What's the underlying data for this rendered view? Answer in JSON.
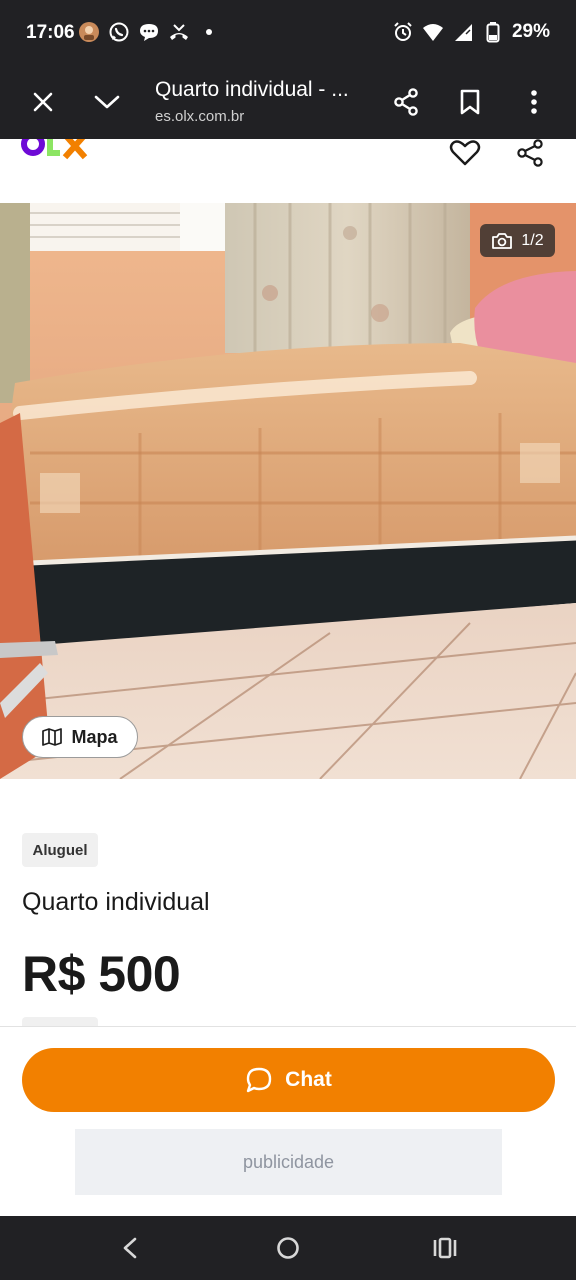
{
  "status_bar": {
    "time": "17:06",
    "battery": "29%",
    "left_icons": [
      "notification-avatar-icon",
      "whatsapp-icon",
      "chat-bubble-icon",
      "missed-call-icon",
      "dot-icon"
    ],
    "right_icons": [
      "alarm-icon",
      "wifi-icon",
      "signal-icon",
      "battery-icon"
    ]
  },
  "tab_bar": {
    "title": "Quarto individual - ...",
    "url": "es.olx.com.br"
  },
  "header": {
    "logo_text": "OLX",
    "colors": {
      "o": "#6e0ad6",
      "l": "#8ce563",
      "x": "#f28000"
    }
  },
  "photo": {
    "counter": "1/2",
    "map_button": "Mapa"
  },
  "listing": {
    "tag": "Aluguel",
    "title": "Quarto individual",
    "price": "R$ 500"
  },
  "actions": {
    "chat_label": "Chat",
    "ad_label": "publicidade",
    "accent": "#f28000"
  }
}
